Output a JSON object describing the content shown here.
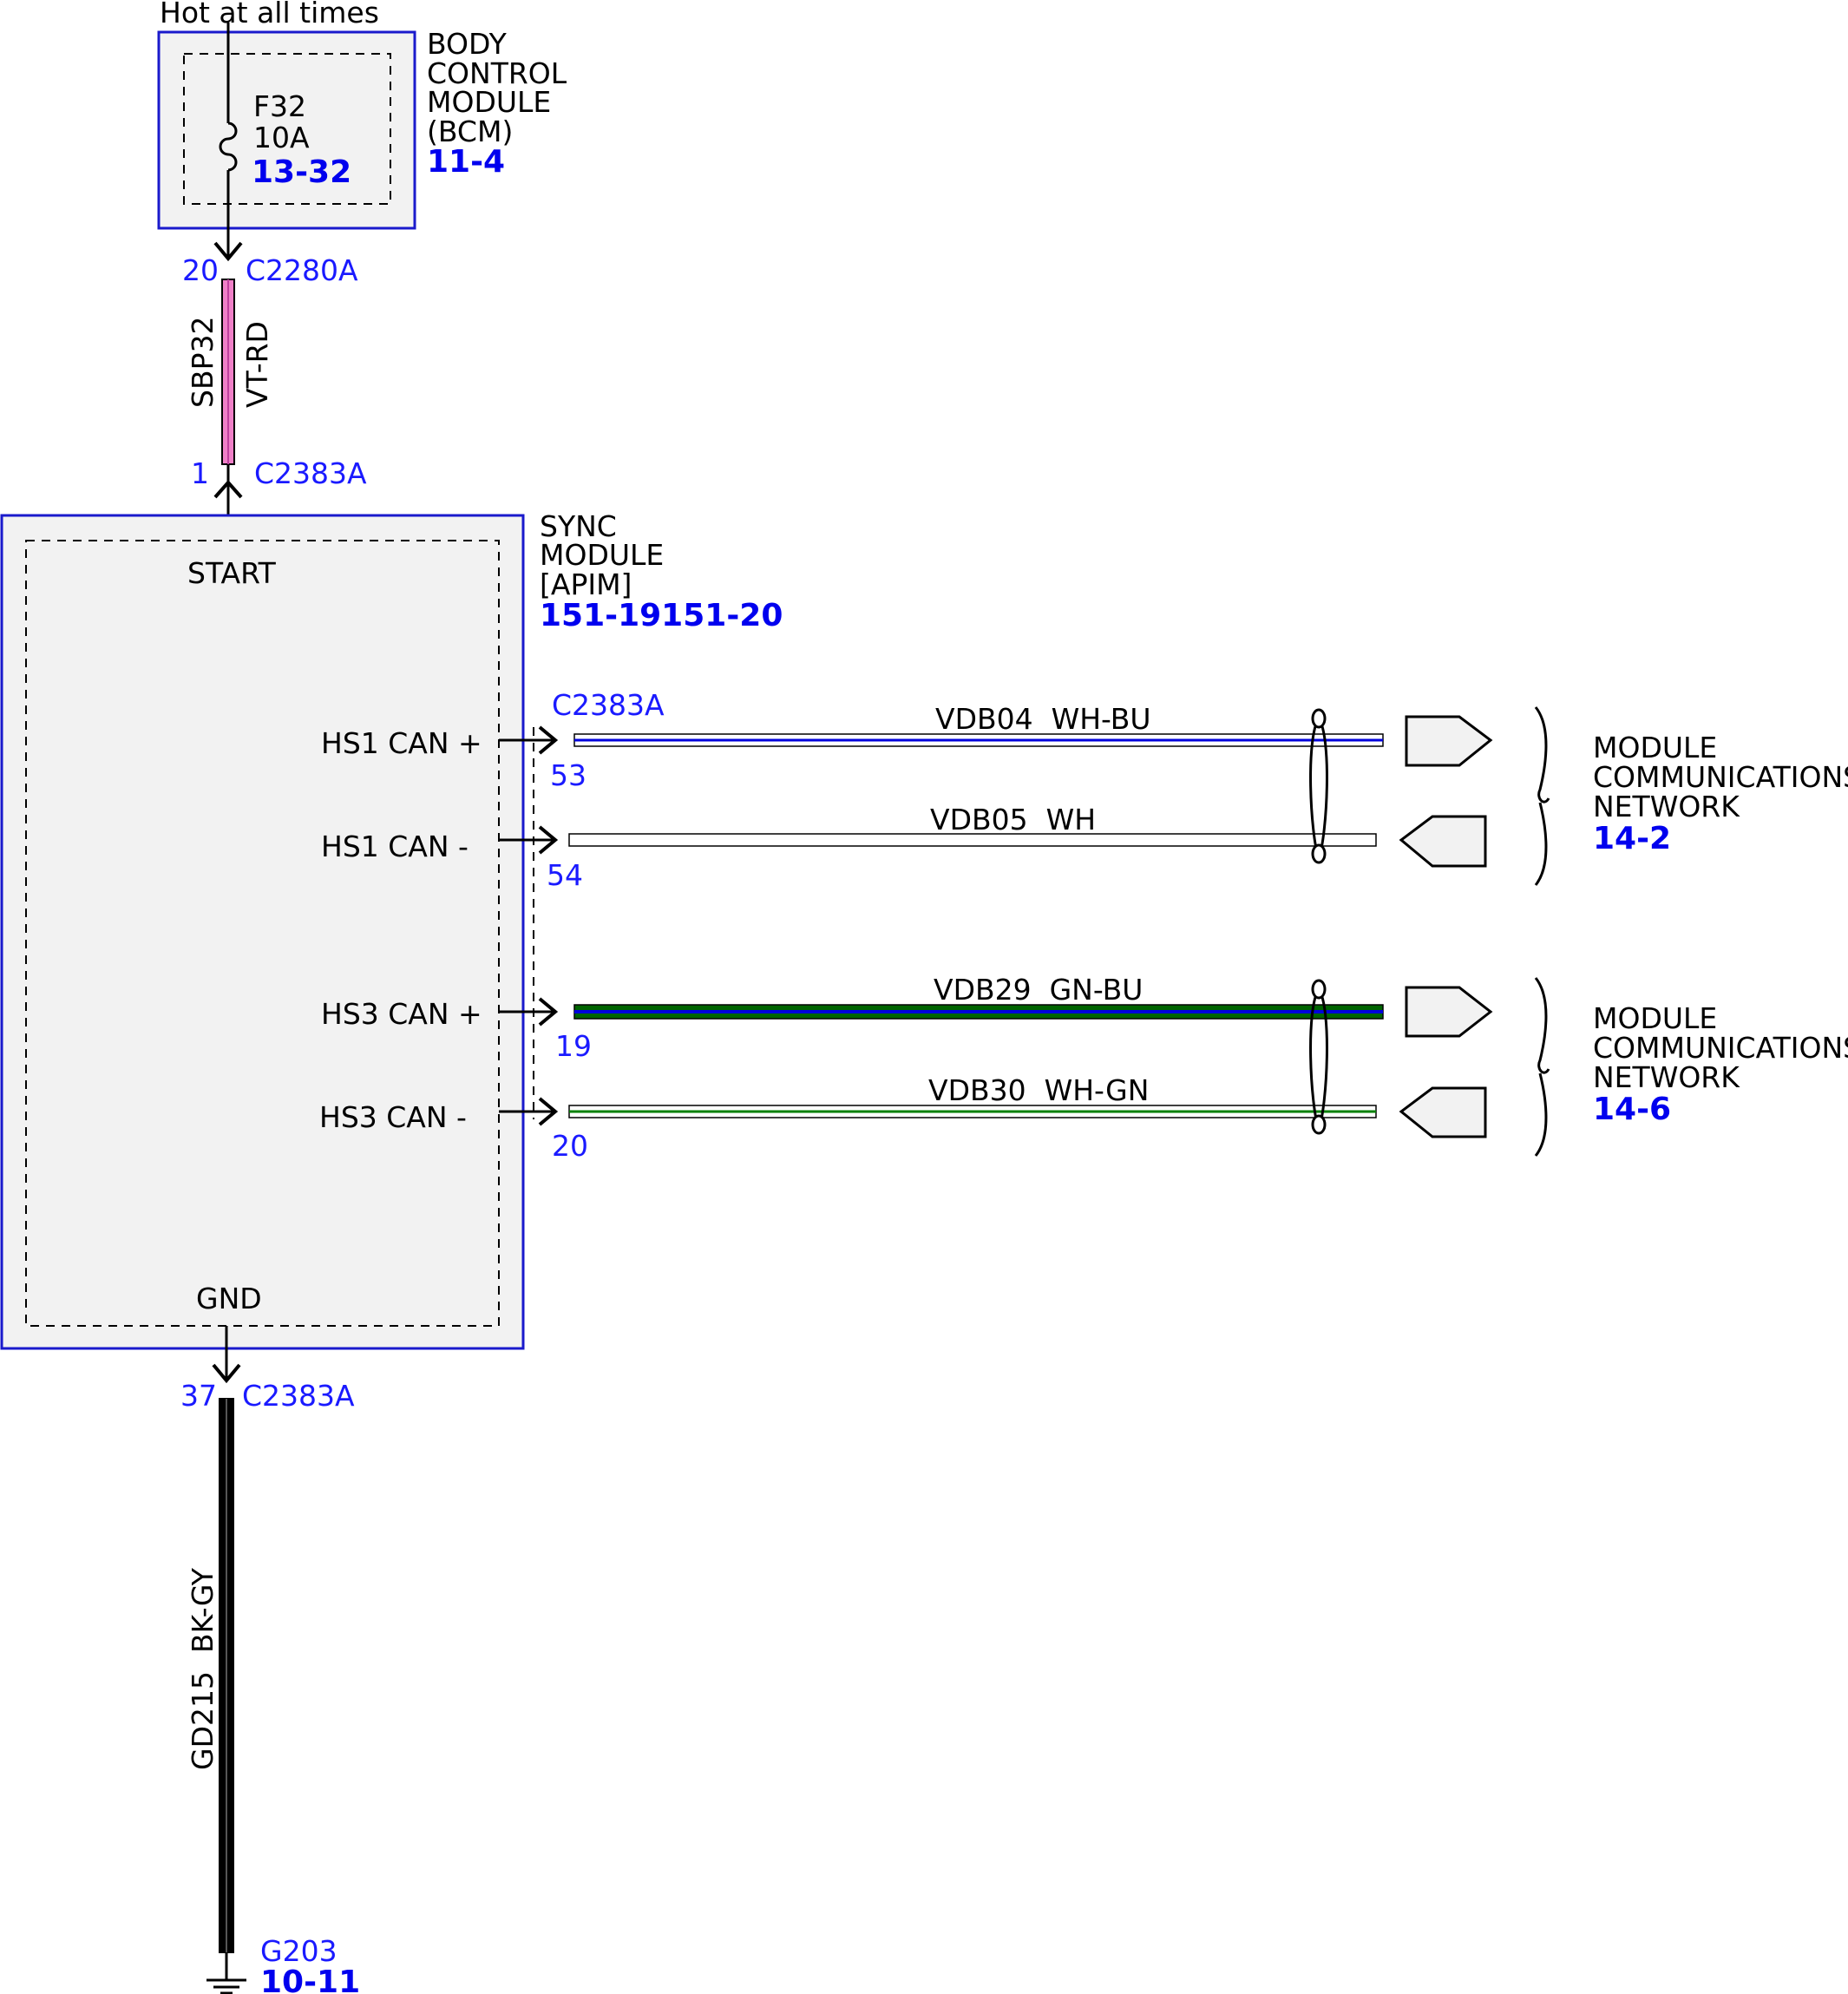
{
  "top": {
    "hot_label": "Hot at all times"
  },
  "bcm": {
    "name_lines": [
      "BODY",
      "CONTROL",
      "MODULE",
      "(BCM)"
    ],
    "ref": "11-4",
    "fuse": {
      "id": "F32",
      "rating": "10A",
      "ref": "13-32"
    }
  },
  "wire_sbp32": {
    "circuit": "SBP32",
    "color_code": "VT-RD",
    "top_pin": "20",
    "top_connector": "C2280A",
    "bottom_pin": "1",
    "bottom_connector": "C2383A",
    "color": "#f080c8"
  },
  "sync": {
    "name_lines": [
      "SYNC",
      "MODULE",
      "[APIM]"
    ],
    "ref": "151-19151-20",
    "start_label": "START",
    "gnd_label": "GND",
    "can_connector": "C2383A",
    "pins": [
      {
        "label": "HS1 CAN +",
        "pin": "53",
        "circuit": "VDB04  WH-BU",
        "stripe": "#0000dd",
        "base": "#ffffff"
      },
      {
        "label": "HS1 CAN -",
        "pin": "54",
        "circuit": "VDB05  WH",
        "stripe": "#ffffff",
        "base": "#ffffff"
      },
      {
        "label": "HS3 CAN +",
        "pin": "19",
        "circuit": "VDB29  GN-BU",
        "stripe": "#0000dd",
        "base": "#006400"
      },
      {
        "label": "HS3 CAN -",
        "pin": "20",
        "circuit": "VDB30  WH-GN",
        "stripe": "#008000",
        "base": "#ffffff"
      }
    ]
  },
  "networks": [
    {
      "lines": [
        "MODULE",
        "COMMUNICATIONS",
        "NETWORK"
      ],
      "ref": "14-2"
    },
    {
      "lines": [
        "MODULE",
        "COMMUNICATIONS",
        "NETWORK"
      ],
      "ref": "14-6"
    }
  ],
  "ground": {
    "pin": "37",
    "connector": "C2383A",
    "circuit": "GD215  BK-GY",
    "point": "G203",
    "ref": "10-11"
  }
}
